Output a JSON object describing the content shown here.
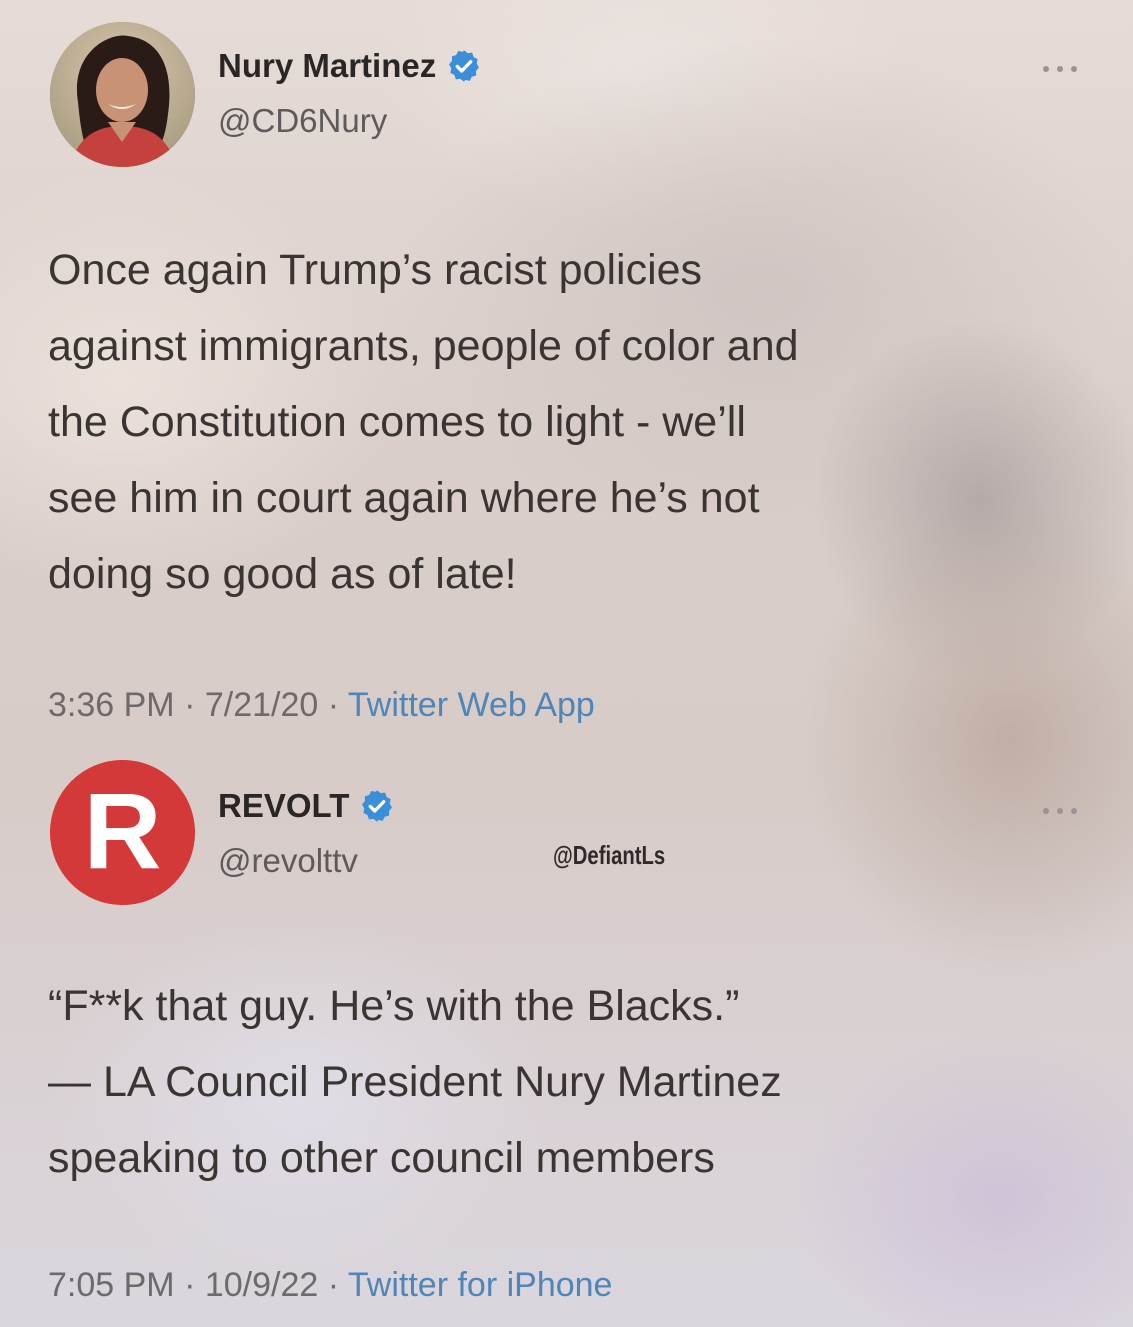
{
  "tweets": [
    {
      "name": "Nury Martinez",
      "handle": "@CD6Nury",
      "verified_icon": "verified-badge-icon",
      "text": "Once again Trump’s racist policies\nagainst immigrants, people of color and\nthe Constitution comes to light - we’ll\nsee him in court again where he’s not\ndoing so good as of late!",
      "time": "3:36 PM",
      "date": "7/21/20",
      "source": "Twitter Web App",
      "more_icon": "more-options-icon"
    },
    {
      "name": "REVOLT",
      "handle": "@revolttv",
      "avatar_letter": "R",
      "verified_icon": "verified-badge-icon",
      "text": "“F**k that guy. He’s with the Blacks.”\n— LA Council President Nury Martinez\nspeaking to other council members",
      "time": "7:05 PM",
      "date": "10/9/22",
      "source": "Twitter for iPhone",
      "more_icon": "more-options-icon"
    }
  ],
  "meta_separator": " · ",
  "watermark": "@DefiantLs",
  "colors": {
    "verified_blue": "#3b8ed8",
    "link_blue": "#4f86b8",
    "revolt_red": "#d4393a"
  }
}
